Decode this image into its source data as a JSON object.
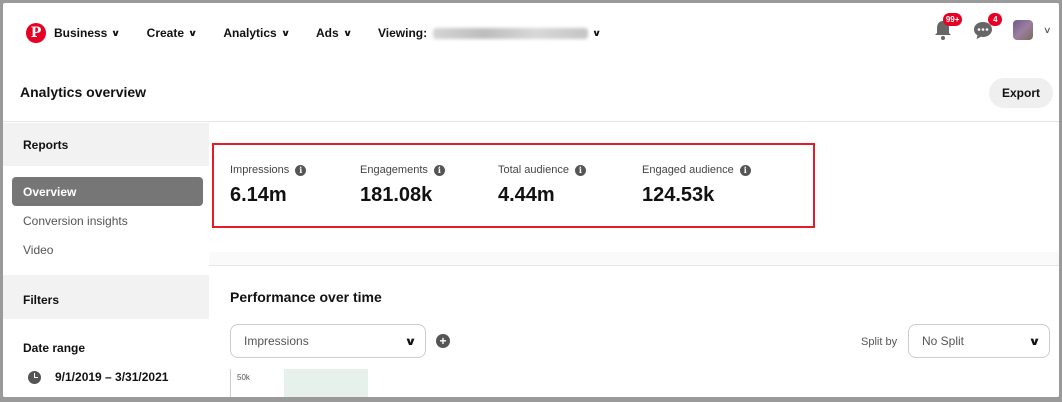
{
  "nav": {
    "logo": "P",
    "items": [
      {
        "label": "Business"
      },
      {
        "label": "Create"
      },
      {
        "label": "Analytics"
      },
      {
        "label": "Ads"
      }
    ],
    "viewing_label": "Viewing:",
    "notifications_badge": "99+",
    "messages_badge": "4"
  },
  "header": {
    "title": "Analytics overview",
    "export_label": "Export"
  },
  "sidebar": {
    "reports_label": "Reports",
    "items": [
      {
        "label": "Overview",
        "active": true
      },
      {
        "label": "Conversion insights",
        "active": false
      },
      {
        "label": "Video",
        "active": false
      }
    ],
    "filters_label": "Filters",
    "date_range_label": "Date range",
    "date_range_value": "9/1/2019 – 3/31/2021"
  },
  "metrics": [
    {
      "label": "Impressions",
      "value": "6.14m"
    },
    {
      "label": "Engagements",
      "value": "181.08k"
    },
    {
      "label": "Total audience",
      "value": "4.44m"
    },
    {
      "label": "Engaged audience",
      "value": "124.53k"
    }
  ],
  "performance": {
    "title": "Performance over time",
    "metric_select": "Impressions",
    "split_by_label": "Split by",
    "split_select": "No Split",
    "y_tick": "50k"
  },
  "colors": {
    "brand": "#e60023",
    "highlight_border": "#e31c25",
    "active_item": "#767676"
  }
}
